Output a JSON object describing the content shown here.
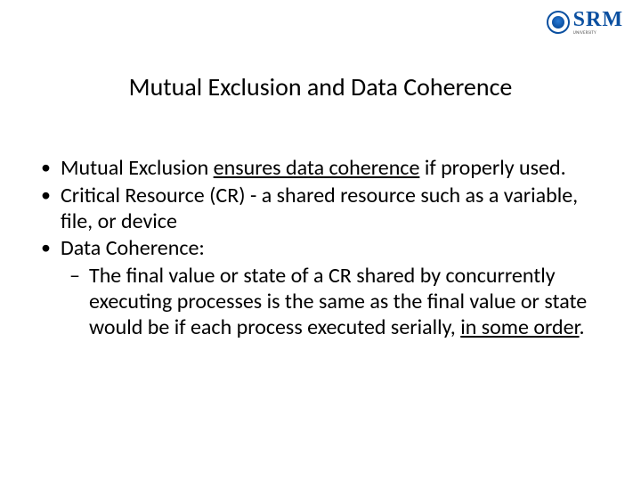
{
  "logo": {
    "name": "SRM",
    "subtitle": "UNIVERSITY"
  },
  "title": "Mutual Exclusion and Data Coherence",
  "bullets": {
    "b1_pre": "Mutual Exclusion ",
    "b1_u": "ensures data coherence",
    "b1_post": " if properly used.",
    "b2": "Critical Resource (CR) - a shared resource such as a variable, file, or device",
    "b3": "Data Coherence:",
    "b3_sub_pre": "The final value or state of a CR shared by concurrently executing processes is the same as the final value or state would be if each process executed serially, ",
    "b3_sub_u": "in some order",
    "b3_sub_post": "."
  }
}
